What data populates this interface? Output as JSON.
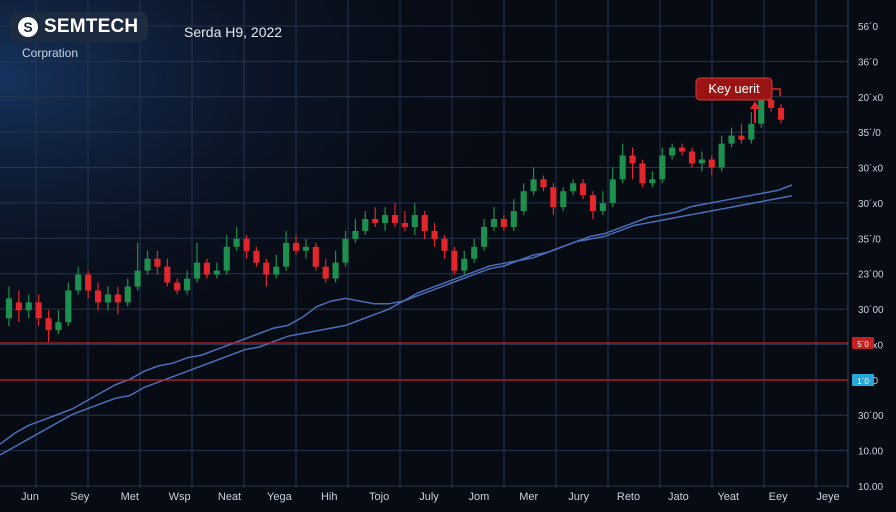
{
  "header": {
    "company": "SEMTECH",
    "subtitle": "Corpration",
    "date": "Serda H9, 2022",
    "logo_icon": "semtech-s-logo"
  },
  "chart_data": {
    "type": "candlestick",
    "grid": true,
    "y_ticks": [
      "56´0",
      "36´0",
      "20´x0",
      "35´/0",
      "30´x0",
      "30´x0",
      "35´/0",
      "23´00",
      "30´00",
      "30´x0",
      "5´00",
      "30´00",
      "10.00",
      "10.00"
    ],
    "x_ticks": [
      "Jun",
      "Sey",
      "Met",
      "Wsp",
      "Neat",
      "Yega",
      "Hih",
      "Tojo",
      "July",
      "Jom",
      "Mer",
      "Jury",
      "Reto",
      "Jato",
      "Yeat",
      "Eey",
      "Jeye"
    ],
    "ylim": [
      0,
      100
    ],
    "candles": [
      [
        38,
        43,
        46,
        36
      ],
      [
        42,
        40,
        45,
        37
      ],
      [
        40,
        42,
        44,
        38
      ],
      [
        42,
        38,
        44,
        36
      ],
      [
        38,
        35,
        40,
        32
      ],
      [
        35,
        37,
        40,
        34
      ],
      [
        37,
        45,
        47,
        36
      ],
      [
        45,
        49,
        51,
        44
      ],
      [
        49,
        45,
        50,
        43
      ],
      [
        45,
        42,
        47,
        40
      ],
      [
        42,
        44,
        46,
        40
      ],
      [
        44,
        42,
        46,
        39
      ],
      [
        42,
        46,
        48,
        41
      ],
      [
        46,
        50,
        57,
        45
      ],
      [
        50,
        53,
        55,
        49
      ],
      [
        53,
        51,
        55,
        49
      ],
      [
        51,
        47,
        53,
        46
      ],
      [
        47,
        45,
        48,
        44
      ],
      [
        45,
        48,
        50,
        44
      ],
      [
        48,
        52,
        57,
        47
      ],
      [
        52,
        49,
        53,
        48
      ],
      [
        49,
        50,
        52,
        48
      ],
      [
        50,
        56,
        59,
        49
      ],
      [
        56,
        58,
        61,
        55
      ],
      [
        58,
        55,
        59,
        53
      ],
      [
        55,
        52,
        56,
        51
      ],
      [
        52,
        49,
        53,
        46
      ],
      [
        49,
        51,
        54,
        48
      ],
      [
        51,
        57,
        60,
        50
      ],
      [
        57,
        55,
        59,
        54
      ],
      [
        55,
        56,
        58,
        53
      ],
      [
        56,
        51,
        57,
        50
      ],
      [
        51,
        48,
        53,
        47
      ],
      [
        48,
        52,
        55,
        47
      ],
      [
        52,
        58,
        60,
        51
      ],
      [
        58,
        60,
        63,
        57
      ],
      [
        60,
        63,
        65,
        59
      ],
      [
        63,
        62,
        66,
        61
      ],
      [
        62,
        64,
        66,
        60
      ],
      [
        64,
        62,
        67,
        61
      ],
      [
        62,
        61,
        65,
        60
      ],
      [
        61,
        64,
        67,
        59
      ],
      [
        64,
        60,
        65,
        58
      ],
      [
        60,
        58,
        62,
        56
      ],
      [
        58,
        55,
        59,
        53
      ],
      [
        55,
        50,
        56,
        49
      ],
      [
        50,
        53,
        55,
        49
      ],
      [
        53,
        56,
        58,
        52
      ],
      [
        56,
        61,
        63,
        55
      ],
      [
        61,
        63,
        66,
        60
      ],
      [
        63,
        61,
        64,
        60
      ],
      [
        61,
        65,
        68,
        60
      ],
      [
        65,
        70,
        72,
        64
      ],
      [
        70,
        73,
        76,
        69
      ],
      [
        73,
        71,
        74,
        70
      ],
      [
        71,
        66,
        72,
        64
      ],
      [
        66,
        70,
        71,
        65
      ],
      [
        70,
        72,
        73,
        69
      ],
      [
        72,
        69,
        73,
        68
      ],
      [
        69,
        65,
        70,
        63
      ],
      [
        65,
        67,
        70,
        64
      ],
      [
        67,
        73,
        76,
        66
      ],
      [
        73,
        79,
        82,
        72
      ],
      [
        79,
        77,
        81,
        73
      ],
      [
        77,
        72,
        78,
        71
      ],
      [
        72,
        73,
        75,
        71
      ],
      [
        73,
        79,
        81,
        72
      ],
      [
        79,
        81,
        82,
        78
      ],
      [
        81,
        80,
        82,
        79
      ],
      [
        80,
        77,
        81,
        76
      ],
      [
        77,
        78,
        80,
        75
      ],
      [
        78,
        76,
        79,
        74
      ],
      [
        76,
        82,
        84,
        75
      ],
      [
        82,
        84,
        86,
        81
      ],
      [
        84,
        83,
        87,
        82
      ],
      [
        83,
        87,
        90,
        82
      ],
      [
        87,
        93,
        95,
        86
      ],
      [
        93,
        91,
        94,
        90
      ],
      [
        91,
        88,
        92,
        87
      ]
    ],
    "ma_series": [
      {
        "values": [
          4,
          8,
          11,
          13,
          15,
          17,
          20,
          23,
          26,
          28,
          31,
          33,
          34,
          36,
          37,
          39,
          41,
          43,
          45,
          47,
          48,
          51,
          55,
          57,
          58,
          57,
          56,
          56,
          57,
          59,
          61,
          63,
          65,
          67,
          69,
          70,
          72,
          74,
          75,
          77,
          79,
          81,
          82,
          84,
          86,
          88,
          89,
          90,
          92,
          93,
          94,
          95,
          96,
          97,
          98,
          100
        ]
      },
      {
        "values": [
          0,
          3,
          6,
          9,
          12,
          15,
          17,
          19,
          21,
          22,
          25,
          27,
          29,
          31,
          33,
          35,
          37,
          39,
          40,
          42,
          44,
          45,
          46,
          47,
          48,
          50,
          52,
          54,
          57,
          60,
          62,
          64,
          66,
          68,
          70,
          71,
          72,
          73,
          75,
          77,
          79,
          80,
          81,
          83,
          85,
          86,
          87,
          88,
          89,
          90,
          91,
          92,
          93,
          94,
          95,
          96
        ]
      }
    ],
    "h_lines": [
      {
        "value": 38,
        "label": "5´0",
        "color": "#c42020"
      },
      {
        "value": 30,
        "label": "1´0",
        "color": "#c42020",
        "badge_color": "#2aa7d9"
      }
    ],
    "annotation": {
      "text": "Key uerit"
    },
    "colors": {
      "up": "#1d8f4e",
      "down": "#e3262b",
      "grid": "#26344d",
      "ma": "#4d6fb8",
      "axis_text": "#c9d2de",
      "bg": "#070b14",
      "annotation_bg": "#9a1414"
    }
  }
}
